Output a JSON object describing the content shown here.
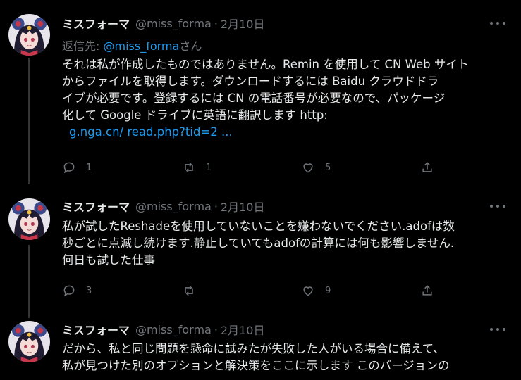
{
  "tweets": [
    {
      "name": "ミスフォーマ",
      "handle": "@miss_forma",
      "separator": "·",
      "date": "2月10日",
      "reply_prefix": "返信先:",
      "reply_mention": "@miss_forma",
      "reply_suffix": "さん",
      "lines": [
        "それは私が作成したものではありません。Remin を使用して CN Web サイト",
        "からファイルを取得します。ダウンロードするには Baidu クラウドドラ",
        "イブが必要です。登録するには CN の電話番号が必要なので、パッケージ",
        "化して Google ドライブに英語に翻訳します http:"
      ],
      "link": "g.nga.cn/ read.php?tid=2 ...",
      "reply_count": "1",
      "retweet_count": "1",
      "like_count": "5"
    },
    {
      "name": "ミスフォーマ",
      "handle": "@miss_forma",
      "separator": "·",
      "date": "2月10日",
      "lines": [
        "私が試したReshadeを使用していないことを嫌わないでください.adofは数",
        "秒ごとに点滅し続けます.静止していてもadofの計算には何も影響しません.",
        "何日も試した仕事"
      ],
      "reply_count": "3",
      "retweet_count": "",
      "like_count": "9"
    },
    {
      "name": "ミスフォーマ",
      "handle": "@miss_forma",
      "separator": "·",
      "date": "2月10日",
      "lines": [
        "だから、私と同じ問題を懸命に試みたが失敗した人がいる場合に備えて、",
        "私が見つけた別のオプションと解決策をここに示します このバージョンの"
      ]
    }
  ],
  "icons": {
    "reply": "reply-icon",
    "retweet": "retweet-icon",
    "like": "heart-icon",
    "share": "share-icon",
    "more": "more-icon"
  },
  "colors": {
    "background": "#000000",
    "text": "#e7e9ea",
    "muted": "#71767b",
    "link": "#1d9bf0",
    "thread_line": "#333639"
  }
}
